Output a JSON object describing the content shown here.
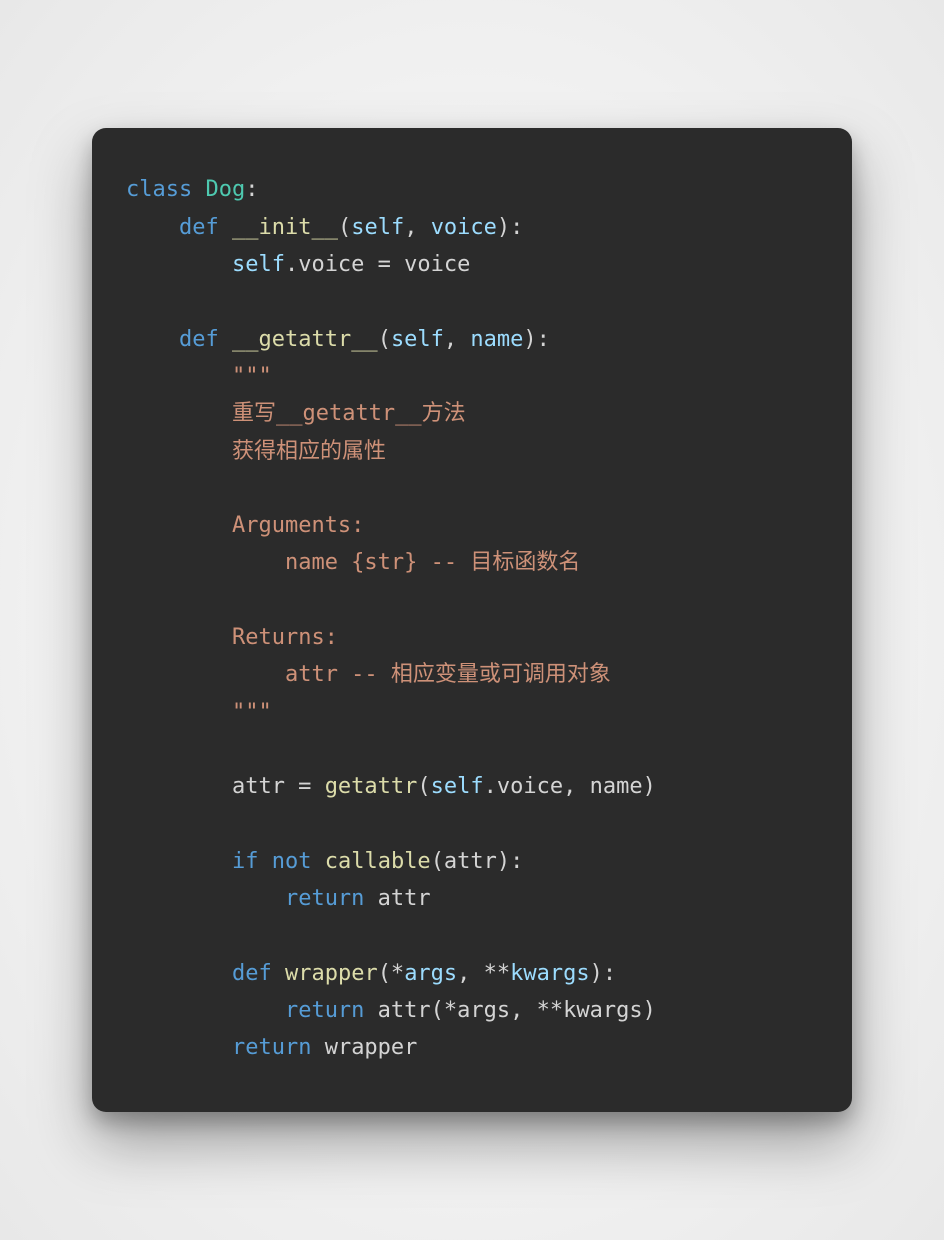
{
  "code": {
    "tokens": [
      [
        {
          "t": "class",
          "c": "kw"
        },
        {
          "t": " "
        },
        {
          "t": "Dog",
          "c": "cls"
        },
        {
          "t": ":",
          "c": "punct"
        }
      ],
      [
        {
          "t": "    "
        },
        {
          "t": "def",
          "c": "kw"
        },
        {
          "t": " "
        },
        {
          "t": "__init__",
          "c": "fn"
        },
        {
          "t": "(",
          "c": "punct"
        },
        {
          "t": "self",
          "c": "param"
        },
        {
          "t": ", ",
          "c": "punct"
        },
        {
          "t": "voice",
          "c": "param"
        },
        {
          "t": "):",
          "c": "punct"
        }
      ],
      [
        {
          "t": "        "
        },
        {
          "t": "self",
          "c": "param"
        },
        {
          "t": ".voice = voice",
          "c": "op"
        }
      ],
      [
        {
          "t": ""
        }
      ],
      [
        {
          "t": "    "
        },
        {
          "t": "def",
          "c": "kw"
        },
        {
          "t": " "
        },
        {
          "t": "__getattr__",
          "c": "fn"
        },
        {
          "t": "(",
          "c": "punct"
        },
        {
          "t": "self",
          "c": "param"
        },
        {
          "t": ", ",
          "c": "punct"
        },
        {
          "t": "name",
          "c": "param"
        },
        {
          "t": "):",
          "c": "punct"
        }
      ],
      [
        {
          "t": "        "
        },
        {
          "t": "\"\"\"",
          "c": "str"
        }
      ],
      [
        {
          "t": "        "
        },
        {
          "t": "重写__getattr__方法",
          "c": "str"
        }
      ],
      [
        {
          "t": "        "
        },
        {
          "t": "获得相应的属性",
          "c": "str"
        }
      ],
      [
        {
          "t": ""
        }
      ],
      [
        {
          "t": "        "
        },
        {
          "t": "Arguments:",
          "c": "str"
        }
      ],
      [
        {
          "t": "            "
        },
        {
          "t": "name {str} -- 目标函数名",
          "c": "str"
        }
      ],
      [
        {
          "t": ""
        }
      ],
      [
        {
          "t": "        "
        },
        {
          "t": "Returns:",
          "c": "str"
        }
      ],
      [
        {
          "t": "            "
        },
        {
          "t": "attr -- 相应变量或可调用对象",
          "c": "str"
        }
      ],
      [
        {
          "t": "        "
        },
        {
          "t": "\"\"\"",
          "c": "str"
        }
      ],
      [
        {
          "t": ""
        }
      ],
      [
        {
          "t": "        attr = "
        },
        {
          "t": "getattr",
          "c": "fn"
        },
        {
          "t": "(",
          "c": "punct"
        },
        {
          "t": "self",
          "c": "param"
        },
        {
          "t": ".voice, name)",
          "c": "op"
        }
      ],
      [
        {
          "t": ""
        }
      ],
      [
        {
          "t": "        "
        },
        {
          "t": "if",
          "c": "kw"
        },
        {
          "t": " "
        },
        {
          "t": "not",
          "c": "kw"
        },
        {
          "t": " "
        },
        {
          "t": "callable",
          "c": "fn"
        },
        {
          "t": "(attr):",
          "c": "punct"
        }
      ],
      [
        {
          "t": "            "
        },
        {
          "t": "return",
          "c": "kw"
        },
        {
          "t": " attr"
        }
      ],
      [
        {
          "t": ""
        }
      ],
      [
        {
          "t": "        "
        },
        {
          "t": "def",
          "c": "kw"
        },
        {
          "t": " "
        },
        {
          "t": "wrapper",
          "c": "fn"
        },
        {
          "t": "(*",
          "c": "punct"
        },
        {
          "t": "args",
          "c": "param"
        },
        {
          "t": ", **",
          "c": "punct"
        },
        {
          "t": "kwargs",
          "c": "param"
        },
        {
          "t": "):",
          "c": "punct"
        }
      ],
      [
        {
          "t": "            "
        },
        {
          "t": "return",
          "c": "kw"
        },
        {
          "t": " attr(*args, **kwargs)"
        }
      ],
      [
        {
          "t": "        "
        },
        {
          "t": "return",
          "c": "kw"
        },
        {
          "t": " wrapper"
        }
      ]
    ]
  }
}
